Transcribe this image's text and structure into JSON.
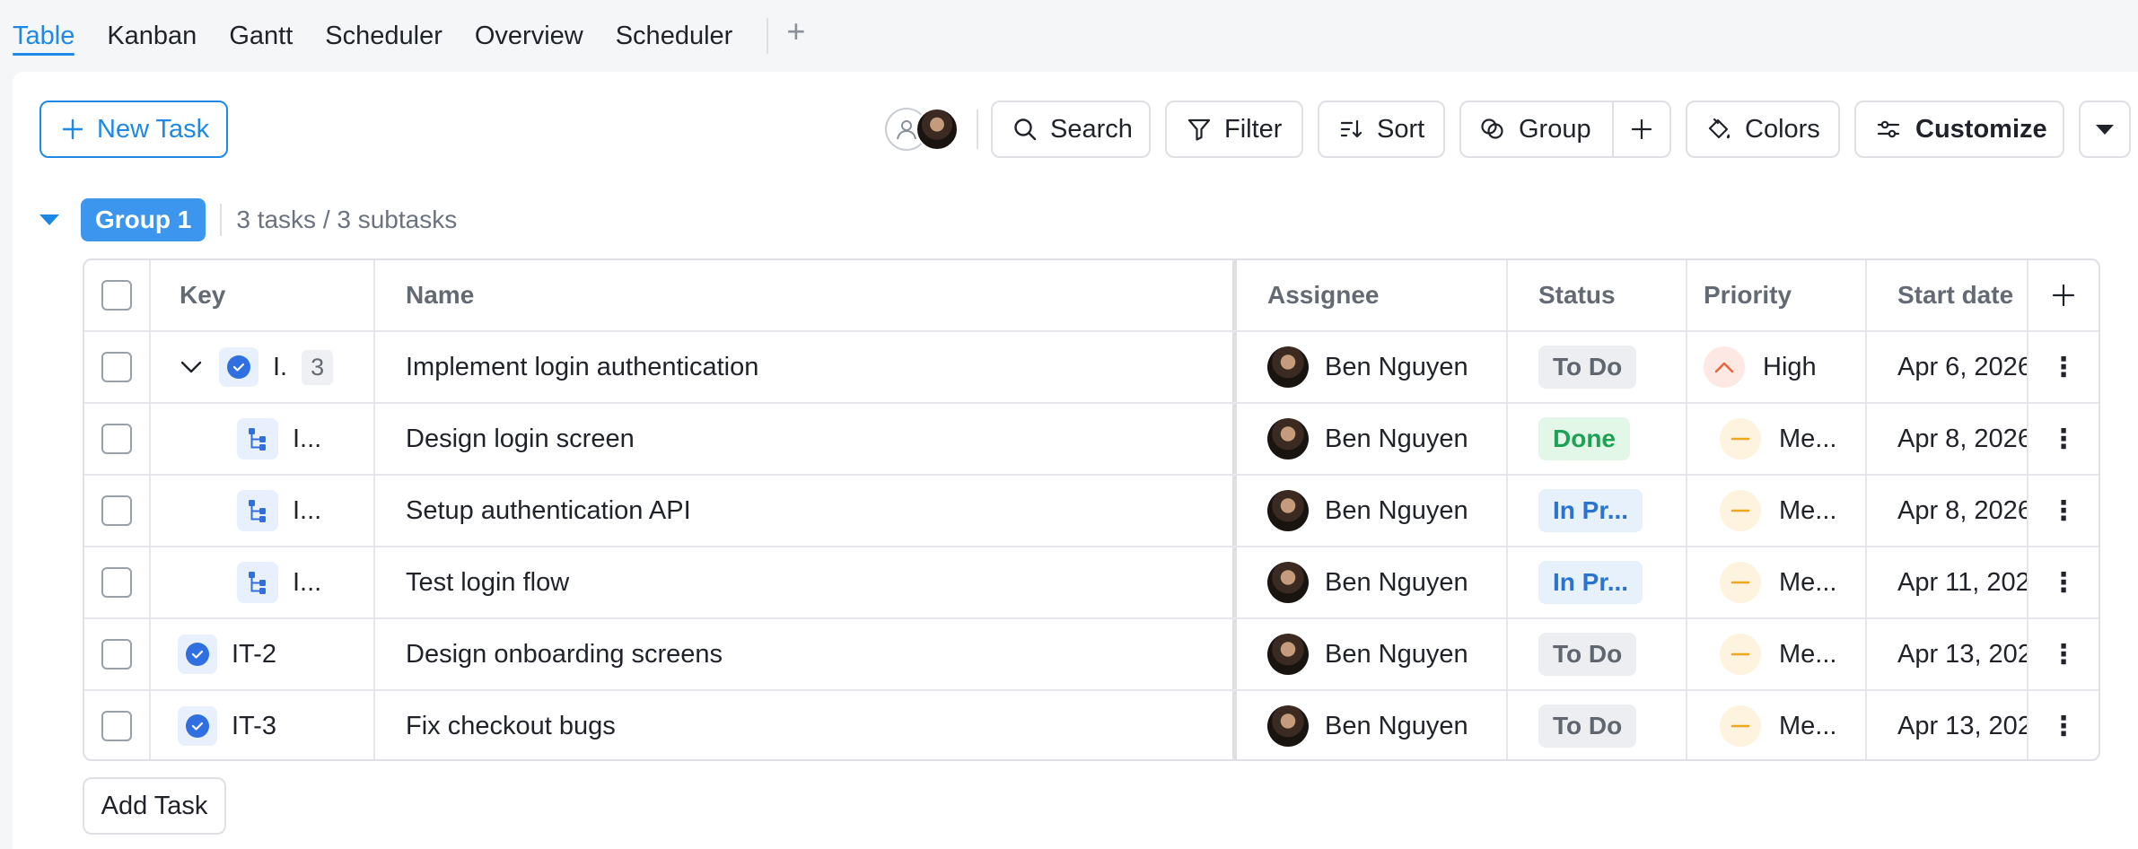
{
  "view_tabs": [
    {
      "label": "Table",
      "active": true
    },
    {
      "label": "Kanban",
      "active": false
    },
    {
      "label": "Gantt",
      "active": false
    },
    {
      "label": "Scheduler",
      "active": false
    },
    {
      "label": "Overview",
      "active": false
    },
    {
      "label": "Scheduler",
      "active": false
    }
  ],
  "toolbar": {
    "new_task": "New Task",
    "search": "Search",
    "filter": "Filter",
    "sort": "Sort",
    "group": "Group",
    "colors": "Colors",
    "customize": "Customize"
  },
  "group": {
    "name": "Group 1",
    "count": "3 tasks / 3 subtasks"
  },
  "columns": {
    "key": "Key",
    "name": "Name",
    "assignee": "Assignee",
    "status": "Status",
    "priority": "Priority",
    "start_date": "Start date"
  },
  "rows": [
    {
      "key": "I.",
      "subtasks": "3",
      "name": "Implement login authentication",
      "assignee": "Ben Nguyen",
      "status": "To Do",
      "priority": "High",
      "start": "Apr 6, 2026"
    },
    {
      "key": "I...",
      "name": "Design login screen",
      "assignee": "Ben Nguyen",
      "status": "Done",
      "priority": "Me...",
      "start": "Apr 8, 2026"
    },
    {
      "key": "I...",
      "name": "Setup authentication API",
      "assignee": "Ben Nguyen",
      "status": "In Pr...",
      "priority": "Me...",
      "start": "Apr 8, 2026"
    },
    {
      "key": "I...",
      "name": "Test login flow",
      "assignee": "Ben Nguyen",
      "status": "In Pr...",
      "priority": "Me...",
      "start": "Apr 11, 202"
    },
    {
      "key": "IT-2",
      "name": "Design onboarding screens",
      "assignee": "Ben Nguyen",
      "status": "To Do",
      "priority": "Me...",
      "start": "Apr 13, 202"
    },
    {
      "key": "IT-3",
      "name": "Fix checkout bugs",
      "assignee": "Ben Nguyen",
      "status": "To Do",
      "priority": "Me...",
      "start": "Apr 13, 202"
    }
  ],
  "footer": {
    "add_task": "Add Task"
  },
  "colors": {
    "accent": "#1e88e5",
    "group_badge": "#3c96ee",
    "done": "#1ea152",
    "in_progress": "#2a74d0",
    "high_priority": "#e8663d",
    "medium_priority": "#f0a81b"
  }
}
